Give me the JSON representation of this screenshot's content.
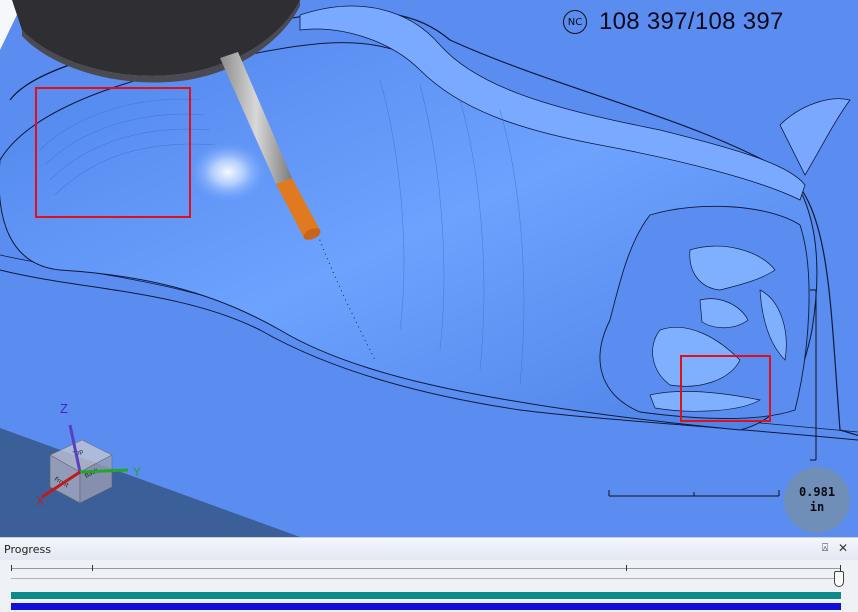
{
  "viewport": {
    "nc_badge": "NC",
    "nc_count": "108 397/108 397",
    "scale": {
      "value": "0.981",
      "unit": "in"
    },
    "axes": {
      "z": "Z",
      "y": "Y",
      "x": "X",
      "cube_top": "Top",
      "cube_front": "Front",
      "cube_back": "Back"
    },
    "colors": {
      "surface": "#5b8df0",
      "highlight_box": "#e0101a",
      "tool_tip": "#e07a20"
    }
  },
  "progress_panel": {
    "title": "Progress",
    "pin_icon": "pin-icon",
    "close_icon": "close-icon",
    "playback_position": 1.0,
    "simulation_progress": 1.0,
    "bar_colors": {
      "primary": "#0e8a8a",
      "secondary": "#1010d8"
    }
  }
}
